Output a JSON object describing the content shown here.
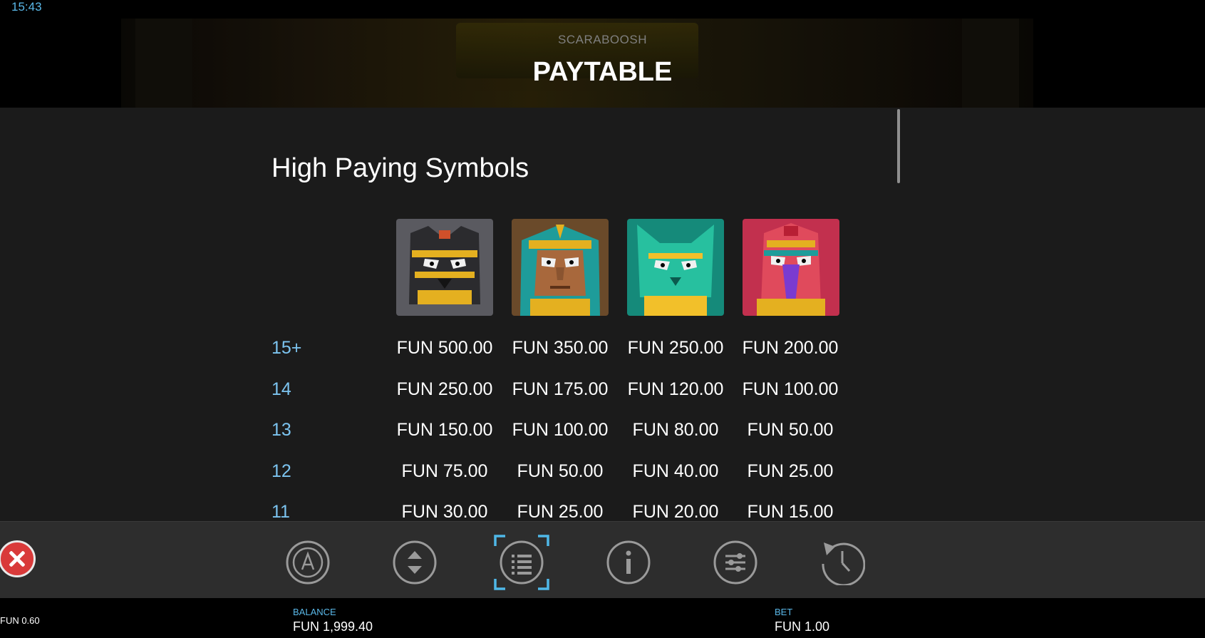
{
  "status_bar": {
    "time": "15:43"
  },
  "header": {
    "game_name": "SCARABOOSH",
    "title": "PAYTABLE"
  },
  "section": {
    "title": "High Paying Symbols"
  },
  "symbols": [
    {
      "name": "black-cat-mask-icon",
      "base": "#2b2b2e",
      "accent": "#e4b020"
    },
    {
      "name": "pharaoh-mask-icon",
      "base": "#8b5a34",
      "accent": "#e4b020"
    },
    {
      "name": "green-cat-mask-icon",
      "base": "#1aa58e",
      "accent": "#f2c02a"
    },
    {
      "name": "bird-mask-icon",
      "base": "#c2304e",
      "accent": "#7a3bd0"
    }
  ],
  "paytable": [
    {
      "count": "15+",
      "pays": [
        "FUN 500.00",
        "FUN 350.00",
        "FUN 250.00",
        "FUN 200.00"
      ]
    },
    {
      "count": "14",
      "pays": [
        "FUN 250.00",
        "FUN 175.00",
        "FUN 120.00",
        "FUN 100.00"
      ]
    },
    {
      "count": "13",
      "pays": [
        "FUN 150.00",
        "FUN 100.00",
        "FUN 80.00",
        "FUN 50.00"
      ]
    },
    {
      "count": "12",
      "pays": [
        "FUN 75.00",
        "FUN 50.00",
        "FUN 40.00",
        "FUN 25.00"
      ]
    },
    {
      "count": "11",
      "pays": [
        "FUN 30.00",
        "FUN 25.00",
        "FUN 20.00",
        "FUN 15.00"
      ]
    }
  ],
  "toolbar": {
    "buttons": [
      "autoplay-icon",
      "bet-adjust-icon",
      "paytable-icon",
      "info-icon",
      "settings-icon",
      "history-icon"
    ],
    "active": "paytable-icon",
    "accent_color": "#4fb8e8"
  },
  "footer": {
    "last_win": "FUN 0.60",
    "balance_label": "BALANCE",
    "balance_value": "FUN 1,999.40",
    "bet_label": "BET",
    "bet_value": "FUN 1.00"
  }
}
